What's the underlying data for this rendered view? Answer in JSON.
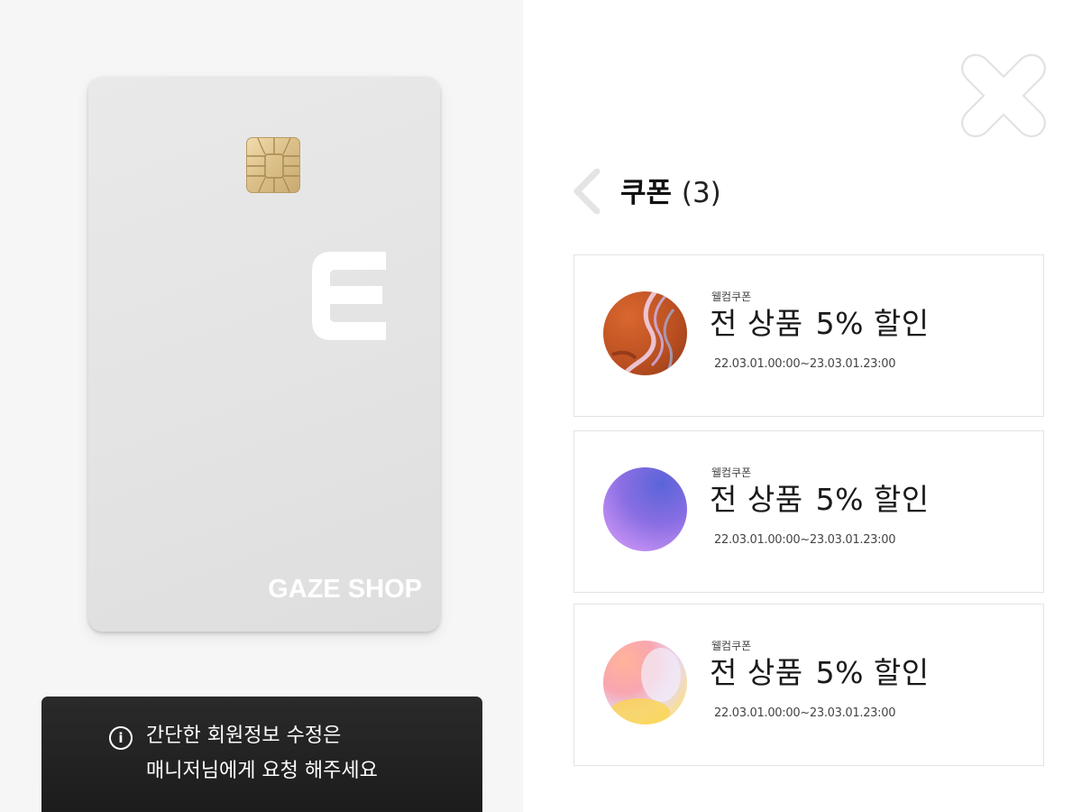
{
  "card": {
    "brand": "GAZE SHOP",
    "logo_icon": "e-letter-logo-icon",
    "chip_icon": "card-chip-icon"
  },
  "notice": {
    "icon": "info-icon",
    "icon_glyph": "i",
    "line1": "간단한 회원정보 수정은",
    "line2": "매니저님에게 요청 해주세요"
  },
  "header": {
    "title": "쿠폰",
    "count": "(3)",
    "back_icon": "chevron-left-icon",
    "close_icon": "close-icon"
  },
  "coupons": [
    {
      "tag": "웰컴쿠폰",
      "name": "전 상품",
      "discount": "5% 할인",
      "period": "22.03.01.00:00~23.03.01.23:00",
      "art_colors": [
        "#d9672f",
        "#b94e20"
      ]
    },
    {
      "tag": "웰컴쿠폰",
      "name": "전 상품",
      "discount": "5% 할인",
      "period": "22.03.01.00:00~23.03.01.23:00",
      "art_colors": [
        "#5a64d8",
        "#c08ef2"
      ]
    },
    {
      "tag": "웰컴쿠폰",
      "name": "전 상품",
      "discount": "5% 할인",
      "period": "22.03.01.00:00~23.03.01.23:00",
      "art_colors": [
        "#ffb39a",
        "#f5c84a"
      ]
    }
  ]
}
